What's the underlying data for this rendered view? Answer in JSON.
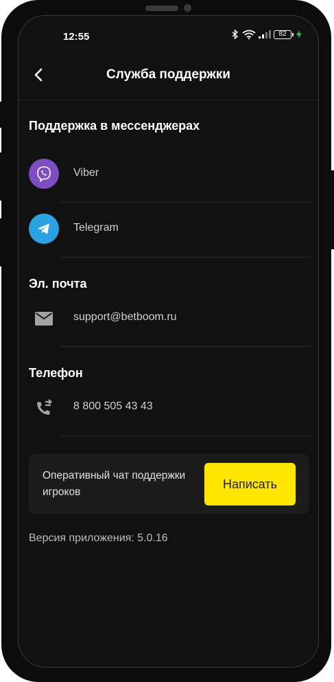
{
  "status_bar": {
    "time": "12:55",
    "battery": "82"
  },
  "header": {
    "title": "Служба поддержки"
  },
  "messengers": {
    "title": "Поддержка в мессенджерах",
    "items": [
      {
        "label": "Viber",
        "icon": "viber-icon",
        "color": "#7d4dc1"
      },
      {
        "label": "Telegram",
        "icon": "telegram-icon",
        "color": "#2aa1e1"
      }
    ]
  },
  "email": {
    "title": "Эл. почта",
    "value": "support@betboom.ru",
    "icon": "mail-icon"
  },
  "phone": {
    "title": "Телефон",
    "value": "8 800 505 43 43",
    "icon": "phone-forward-icon"
  },
  "chat": {
    "text": "Оперативный чат поддержки игроков",
    "button_label": "Написать",
    "button_color": "#ffe600"
  },
  "footer": {
    "version": "Версия приложения: 5.0.16"
  }
}
